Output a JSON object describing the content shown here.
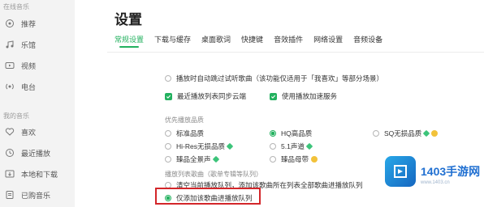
{
  "sidebar": {
    "sections": [
      {
        "title": "在线音乐",
        "items": [
          {
            "label": "推荐",
            "icon": "home-icon"
          },
          {
            "label": "乐馆",
            "icon": "music-hall-icon"
          },
          {
            "label": "视频",
            "icon": "video-icon"
          },
          {
            "label": "电台",
            "icon": "radio-icon"
          }
        ]
      },
      {
        "title": "我的音乐",
        "items": [
          {
            "label": "喜欢",
            "icon": "heart-icon"
          },
          {
            "label": "最近播放",
            "icon": "recent-icon"
          },
          {
            "label": "本地和下载",
            "icon": "download-icon"
          },
          {
            "label": "已购音乐",
            "icon": "purchased-icon"
          }
        ]
      }
    ]
  },
  "main": {
    "title": "设置",
    "tabs": [
      {
        "label": "常规设置",
        "active": true
      },
      {
        "label": "下载与缓存",
        "active": false
      },
      {
        "label": "桌面歌词",
        "active": false
      },
      {
        "label": "快捷键",
        "active": false
      },
      {
        "label": "音效插件",
        "active": false
      },
      {
        "label": "网络设置",
        "active": false
      },
      {
        "label": "音频设备",
        "active": false
      }
    ],
    "playback": {
      "skip_trial": "播放时自动跳过试听歌曲（该功能仅适用于「我喜欢」等部分场景）",
      "sync_recent": "最近播放列表同步云端",
      "accelerate": "使用播放加速服务"
    },
    "quality": {
      "label": "优先播放品质",
      "options": [
        {
          "label": "标准品质"
        },
        {
          "label": "HQ高品质",
          "selected": true
        },
        {
          "label": "SQ无损品质"
        },
        {
          "label": "Hi-Res无损品质"
        },
        {
          "label": "5.1声道"
        },
        {
          "label": "臻品全景声"
        },
        {
          "label": "臻品母带"
        }
      ]
    },
    "queue": {
      "label": "播放列表歌曲（歌单专辑等队列）",
      "options": [
        {
          "label": "清空当前播放队列，添加该歌曲所在列表全部歌曲进播放队列",
          "selected": false
        },
        {
          "label": "仅添加该歌曲进播放队列",
          "selected": true
        }
      ]
    }
  },
  "watermark": {
    "text": "1403手游网",
    "sub": "www.1403.cn"
  },
  "colors": {
    "accent": "#23b15f",
    "highlight": "#d3262a"
  }
}
